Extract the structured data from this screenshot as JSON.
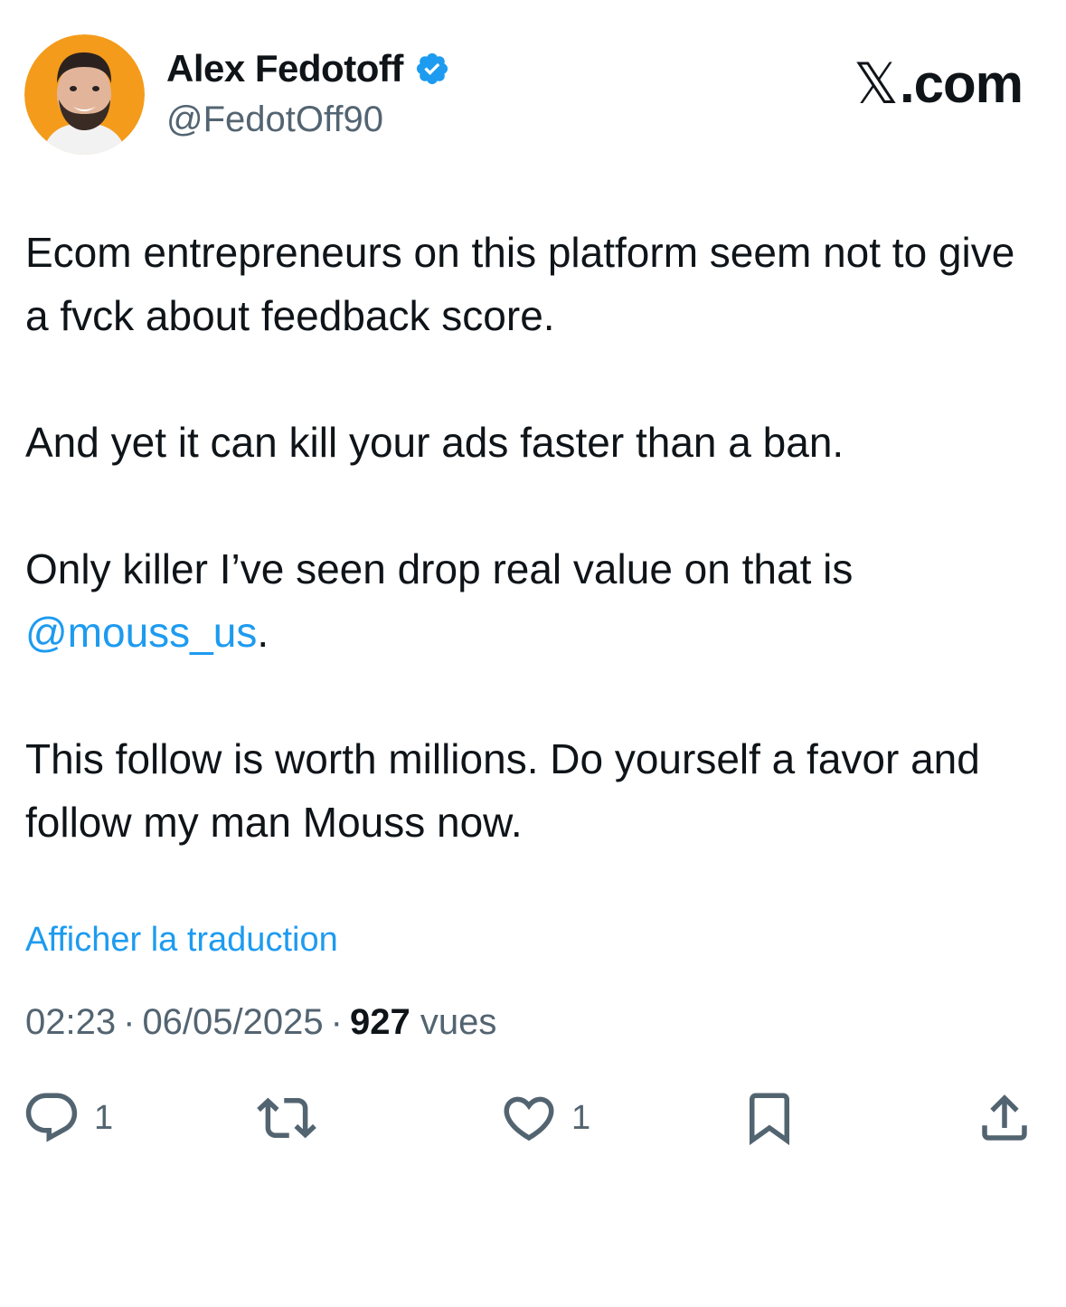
{
  "author": {
    "display_name": "Alex Fedotoff",
    "handle": "@FedotOff90",
    "verified": true,
    "verified_color": "#1d9bf0"
  },
  "brand": {
    "label": ".com",
    "glyph": "𝕏"
  },
  "tweet": {
    "paragraphs": [
      "Ecom entrepreneurs on this platform seem not to give a fvck about feedback score.",
      "And yet it can kill your ads faster than a ban."
    ],
    "para3_before": "Only killer I’ve seen drop real value on that is ",
    "mention": "@mouss_us",
    "para3_after": ".",
    "para4": "This follow is worth millions. Do yourself a favor and follow my man Mouss now."
  },
  "translate_label": "Afficher la traduction",
  "meta": {
    "time": "02:23",
    "separator": "·",
    "date": "06/05/2025",
    "views_count": "927",
    "views_label": "vues"
  },
  "actions": {
    "reply": {
      "icon": "reply-icon",
      "count": "1"
    },
    "repost": {
      "icon": "repost-icon",
      "count": ""
    },
    "like": {
      "icon": "heart-icon",
      "count": "1"
    },
    "bookmark": {
      "icon": "bookmark-icon"
    },
    "share": {
      "icon": "share-icon"
    }
  },
  "colors": {
    "text": "#0f1419",
    "secondary": "#536471",
    "accent": "#1d9bf0",
    "avatar_bg": "#f5a623"
  }
}
